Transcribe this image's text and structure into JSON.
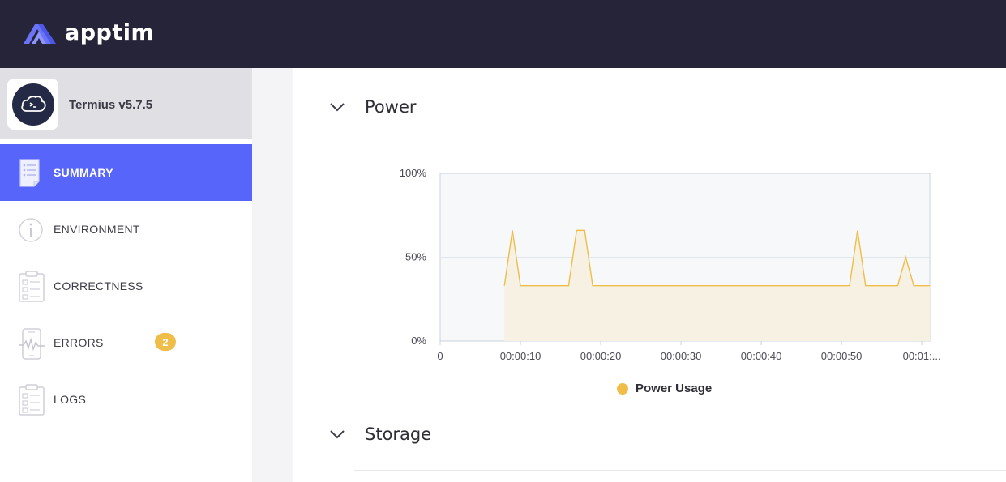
{
  "header": {
    "brand": "apptim"
  },
  "app": {
    "name": "Termius v5.7.5",
    "icon": "termius-cloud-icon"
  },
  "nav": [
    {
      "label": "SUMMARY",
      "icon": "document-icon",
      "active": true
    },
    {
      "label": "ENVIRONMENT",
      "icon": "info-icon",
      "active": false
    },
    {
      "label": "CORRECTNESS",
      "icon": "clipboard-icon",
      "active": false
    },
    {
      "label": "ERRORS",
      "icon": "broken-phone-icon",
      "active": false,
      "badge": "2"
    },
    {
      "label": "LOGS",
      "icon": "clipboard-icon",
      "active": false
    }
  ],
  "sections": {
    "power": {
      "title": "Power"
    },
    "storage": {
      "title": "Storage"
    }
  },
  "colors": {
    "accent": "#5865fa",
    "header_bg": "#262438",
    "series": "#f0bd49",
    "badge": "#f0bd49"
  },
  "chart_data": {
    "type": "area",
    "title": "",
    "xlabel": "",
    "ylabel": "",
    "xlim": [
      0,
      61
    ],
    "ylim": [
      0,
      100
    ],
    "x_ticks": [
      "0",
      "00:00:10",
      "00:00:20",
      "00:00:30",
      "00:00:40",
      "00:00:50",
      "00:01:..."
    ],
    "x_tick_values": [
      0,
      10,
      20,
      30,
      40,
      50,
      60
    ],
    "y_ticks": [
      "0%",
      "50%",
      "100%"
    ],
    "y_tick_values": [
      0,
      50,
      100
    ],
    "grid": true,
    "legend_position": "bottom",
    "series": [
      {
        "name": "Power Usage",
        "color": "#f0bd49",
        "x": [
          8,
          9,
          10,
          16,
          17,
          18,
          19,
          51,
          52,
          53,
          57,
          58,
          59,
          61
        ],
        "y": [
          33,
          66,
          33,
          33,
          66,
          66,
          33,
          33,
          66,
          33,
          33,
          50,
          33,
          33
        ]
      }
    ]
  }
}
